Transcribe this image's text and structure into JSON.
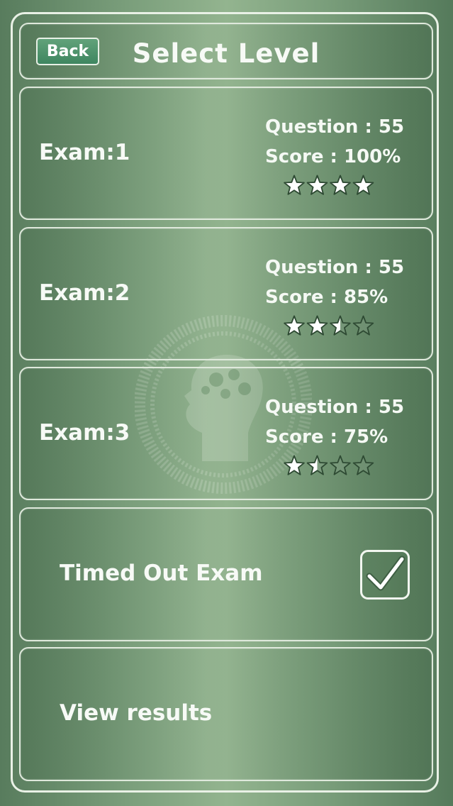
{
  "header": {
    "back_label": "Back",
    "title": "Select Level"
  },
  "exams": [
    {
      "name": "Exam:1",
      "question_text": "Question : 55",
      "score_text": "Score : 100%",
      "stars": 4
    },
    {
      "name": "Exam:2",
      "question_text": "Question : 55",
      "score_text": "Score : 85%",
      "stars": 2.5
    },
    {
      "name": "Exam:3",
      "question_text": "Question : 55",
      "score_text": "Score : 75%",
      "stars": 1.5
    }
  ],
  "timed_out": {
    "label": "Timed Out Exam",
    "checked": true
  },
  "view_results": {
    "label": "View results"
  },
  "stars_max": 4,
  "icons": {
    "star": "star-icon",
    "check": "checkmark-icon",
    "watermark": "brain-head-icon"
  },
  "colors": {
    "background": "#7a9e7b",
    "back_button": "#4f9569",
    "border": "#e9f1e6"
  }
}
